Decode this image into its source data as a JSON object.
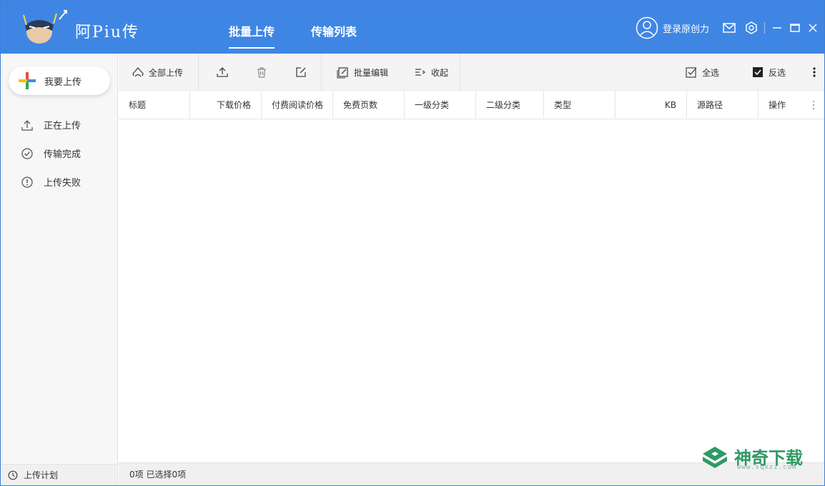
{
  "header": {
    "logo_text": "阿Piu传",
    "tabs": [
      {
        "label": "批量上传",
        "active": true
      },
      {
        "label": "传输列表",
        "active": false
      }
    ],
    "login_text": "登录原创力",
    "icons": [
      "avatar-icon",
      "mail-icon",
      "settings-icon",
      "minimize-icon",
      "maximize-icon",
      "close-icon"
    ],
    "color": "#3f86e4"
  },
  "sidebar": {
    "upload_button": "我要上传",
    "items": [
      {
        "label": "正在上传",
        "icon": "upload-arrow-icon"
      },
      {
        "label": "传输完成",
        "icon": "check-circle-icon"
      },
      {
        "label": "上传失败",
        "icon": "alert-circle-icon"
      }
    ],
    "plan_label": "上传计划"
  },
  "toolbar": {
    "upload_all": "全部上传",
    "batch_edit": "批量编辑",
    "collapse": "收起",
    "select_all": "全选",
    "invert_select": "反选"
  },
  "table": {
    "columns": [
      "标题",
      "下载价格",
      "付费阅读价格",
      "免费页数",
      "一级分类",
      "二级分类",
      "类型",
      "KB",
      "源路径",
      "操作"
    ],
    "rows": []
  },
  "status": {
    "text": "0项 已选择0项"
  },
  "watermark": {
    "text": "神奇下载",
    "url": "www.sqxzz.com"
  }
}
